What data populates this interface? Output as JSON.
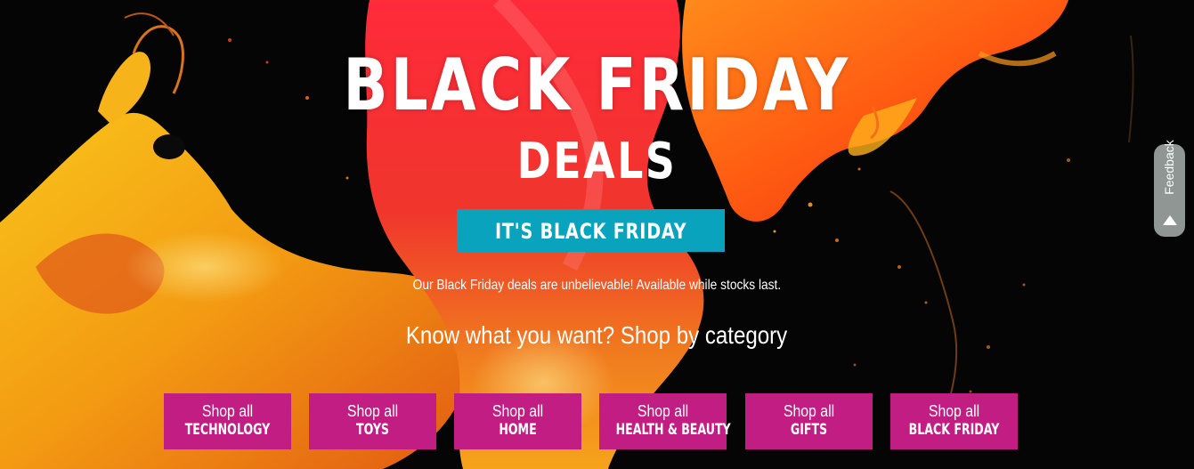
{
  "hero": {
    "title": "BLACK FRIDAY",
    "subtitle": "DEALS",
    "cta_label": "IT'S BLACK FRIDAY",
    "tagline": "Our Black Friday deals are unbelievable! Available while stocks last.",
    "category_heading": "Know what you want? Shop by category"
  },
  "categories": [
    {
      "line1": "Shop all",
      "line2": "TECHNOLOGY"
    },
    {
      "line1": "Shop all",
      "line2": "TOYS"
    },
    {
      "line1": "Shop all",
      "line2": "HOME"
    },
    {
      "line1": "Shop all",
      "line2": "HEALTH & BEAUTY"
    },
    {
      "line1": "Shop all",
      "line2": "GIFTS"
    },
    {
      "line1": "Shop all",
      "line2": "BLACK FRIDAY"
    }
  ],
  "feedback": {
    "label": "Feedback",
    "icon": "triangle-up-icon"
  },
  "colors": {
    "background": "#050505",
    "cta": "#0aa3bd",
    "category_button": "#c11d82",
    "feedback_tab": "#8f9693",
    "text": "#ffffff"
  }
}
